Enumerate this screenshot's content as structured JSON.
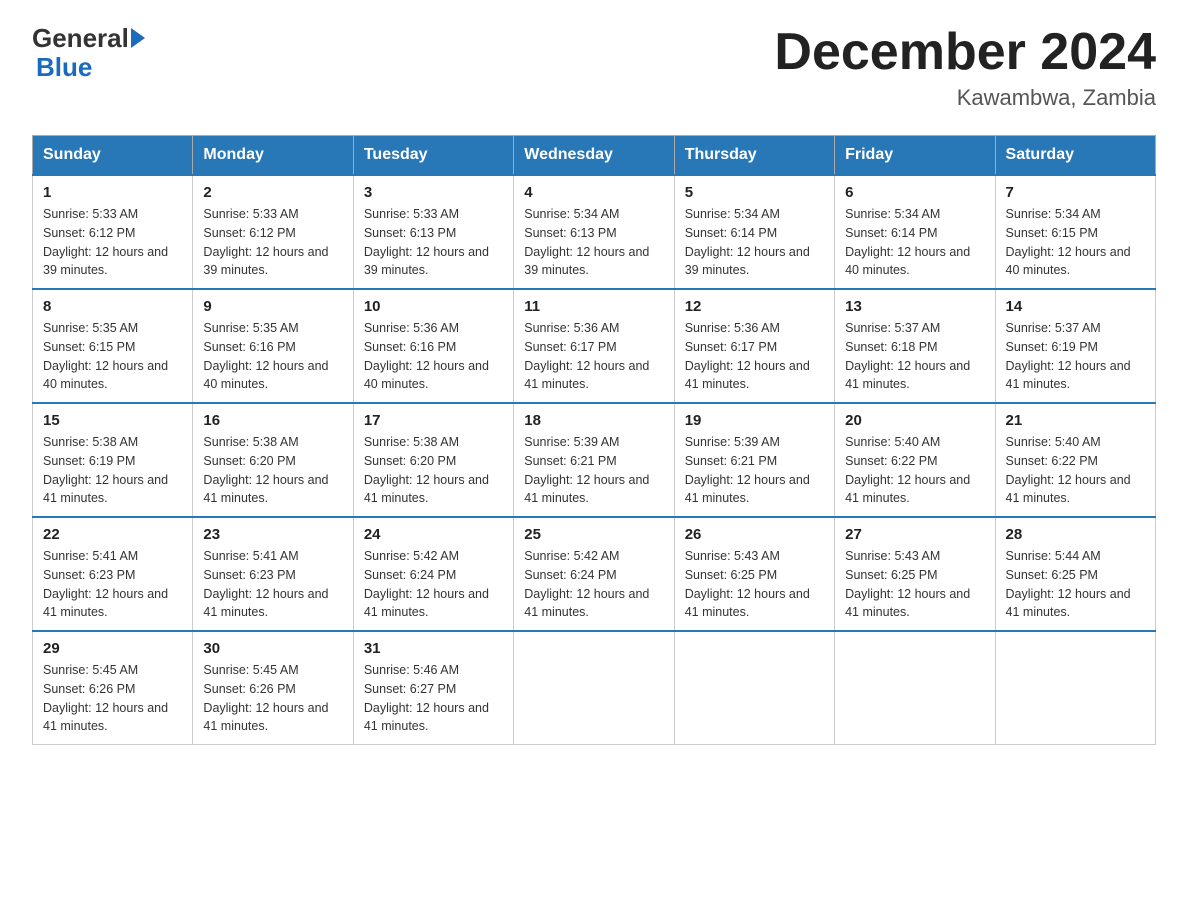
{
  "header": {
    "logo_general": "General",
    "logo_blue": "Blue",
    "title": "December 2024",
    "subtitle": "Kawambwa, Zambia"
  },
  "days_of_week": [
    "Sunday",
    "Monday",
    "Tuesday",
    "Wednesday",
    "Thursday",
    "Friday",
    "Saturday"
  ],
  "weeks": [
    [
      {
        "day": "1",
        "sunrise": "5:33 AM",
        "sunset": "6:12 PM",
        "daylight": "12 hours and 39 minutes."
      },
      {
        "day": "2",
        "sunrise": "5:33 AM",
        "sunset": "6:12 PM",
        "daylight": "12 hours and 39 minutes."
      },
      {
        "day": "3",
        "sunrise": "5:33 AM",
        "sunset": "6:13 PM",
        "daylight": "12 hours and 39 minutes."
      },
      {
        "day": "4",
        "sunrise": "5:34 AM",
        "sunset": "6:13 PM",
        "daylight": "12 hours and 39 minutes."
      },
      {
        "day": "5",
        "sunrise": "5:34 AM",
        "sunset": "6:14 PM",
        "daylight": "12 hours and 39 minutes."
      },
      {
        "day": "6",
        "sunrise": "5:34 AM",
        "sunset": "6:14 PM",
        "daylight": "12 hours and 40 minutes."
      },
      {
        "day": "7",
        "sunrise": "5:34 AM",
        "sunset": "6:15 PM",
        "daylight": "12 hours and 40 minutes."
      }
    ],
    [
      {
        "day": "8",
        "sunrise": "5:35 AM",
        "sunset": "6:15 PM",
        "daylight": "12 hours and 40 minutes."
      },
      {
        "day": "9",
        "sunrise": "5:35 AM",
        "sunset": "6:16 PM",
        "daylight": "12 hours and 40 minutes."
      },
      {
        "day": "10",
        "sunrise": "5:36 AM",
        "sunset": "6:16 PM",
        "daylight": "12 hours and 40 minutes."
      },
      {
        "day": "11",
        "sunrise": "5:36 AM",
        "sunset": "6:17 PM",
        "daylight": "12 hours and 41 minutes."
      },
      {
        "day": "12",
        "sunrise": "5:36 AM",
        "sunset": "6:17 PM",
        "daylight": "12 hours and 41 minutes."
      },
      {
        "day": "13",
        "sunrise": "5:37 AM",
        "sunset": "6:18 PM",
        "daylight": "12 hours and 41 minutes."
      },
      {
        "day": "14",
        "sunrise": "5:37 AM",
        "sunset": "6:19 PM",
        "daylight": "12 hours and 41 minutes."
      }
    ],
    [
      {
        "day": "15",
        "sunrise": "5:38 AM",
        "sunset": "6:19 PM",
        "daylight": "12 hours and 41 minutes."
      },
      {
        "day": "16",
        "sunrise": "5:38 AM",
        "sunset": "6:20 PM",
        "daylight": "12 hours and 41 minutes."
      },
      {
        "day": "17",
        "sunrise": "5:38 AM",
        "sunset": "6:20 PM",
        "daylight": "12 hours and 41 minutes."
      },
      {
        "day": "18",
        "sunrise": "5:39 AM",
        "sunset": "6:21 PM",
        "daylight": "12 hours and 41 minutes."
      },
      {
        "day": "19",
        "sunrise": "5:39 AM",
        "sunset": "6:21 PM",
        "daylight": "12 hours and 41 minutes."
      },
      {
        "day": "20",
        "sunrise": "5:40 AM",
        "sunset": "6:22 PM",
        "daylight": "12 hours and 41 minutes."
      },
      {
        "day": "21",
        "sunrise": "5:40 AM",
        "sunset": "6:22 PM",
        "daylight": "12 hours and 41 minutes."
      }
    ],
    [
      {
        "day": "22",
        "sunrise": "5:41 AM",
        "sunset": "6:23 PM",
        "daylight": "12 hours and 41 minutes."
      },
      {
        "day": "23",
        "sunrise": "5:41 AM",
        "sunset": "6:23 PM",
        "daylight": "12 hours and 41 minutes."
      },
      {
        "day": "24",
        "sunrise": "5:42 AM",
        "sunset": "6:24 PM",
        "daylight": "12 hours and 41 minutes."
      },
      {
        "day": "25",
        "sunrise": "5:42 AM",
        "sunset": "6:24 PM",
        "daylight": "12 hours and 41 minutes."
      },
      {
        "day": "26",
        "sunrise": "5:43 AM",
        "sunset": "6:25 PM",
        "daylight": "12 hours and 41 minutes."
      },
      {
        "day": "27",
        "sunrise": "5:43 AM",
        "sunset": "6:25 PM",
        "daylight": "12 hours and 41 minutes."
      },
      {
        "day": "28",
        "sunrise": "5:44 AM",
        "sunset": "6:25 PM",
        "daylight": "12 hours and 41 minutes."
      }
    ],
    [
      {
        "day": "29",
        "sunrise": "5:45 AM",
        "sunset": "6:26 PM",
        "daylight": "12 hours and 41 minutes."
      },
      {
        "day": "30",
        "sunrise": "5:45 AM",
        "sunset": "6:26 PM",
        "daylight": "12 hours and 41 minutes."
      },
      {
        "day": "31",
        "sunrise": "5:46 AM",
        "sunset": "6:27 PM",
        "daylight": "12 hours and 41 minutes."
      },
      null,
      null,
      null,
      null
    ]
  ]
}
